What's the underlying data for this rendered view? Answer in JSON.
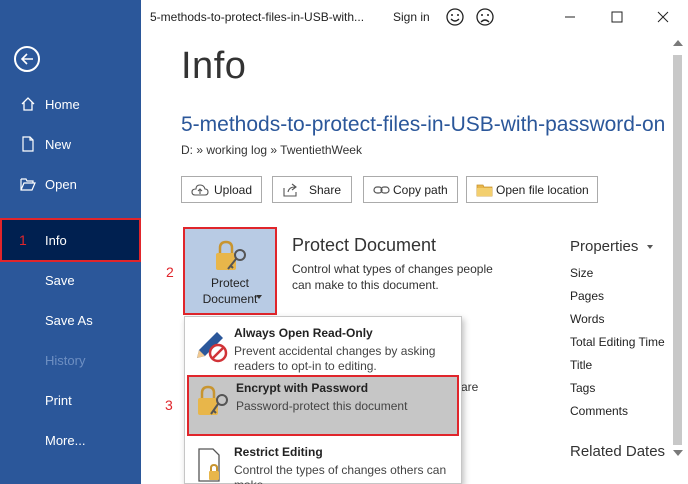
{
  "sidebar": {
    "items": [
      {
        "label": "Home",
        "icon": "home-icon"
      },
      {
        "label": "New",
        "icon": "new-document-icon"
      },
      {
        "label": "Open",
        "icon": "open-folder-icon"
      },
      {
        "label": "Info"
      },
      {
        "label": "Save"
      },
      {
        "label": "Save As"
      },
      {
        "label": "History",
        "disabled": true
      },
      {
        "label": "Print"
      },
      {
        "label": "More..."
      }
    ],
    "active_item": "Info"
  },
  "annotations": {
    "step1": "1",
    "step2": "2",
    "step3": "3"
  },
  "titlebar": {
    "doc_title": "5-methods-to-protect-files-in-USB-with...",
    "sign_in": "Sign in",
    "icons": [
      "smile-icon",
      "frown-icon",
      "minimize-icon",
      "maximize-icon",
      "close-icon"
    ]
  },
  "main": {
    "page_title": "Info",
    "doc_name": "5-methods-to-protect-files-in-USB-with-password-on",
    "doc_path": "D: » working log » TwentiethWeek",
    "actions": [
      {
        "label": "Upload",
        "icon": "upload-cloud-icon"
      },
      {
        "label": "Share",
        "icon": "share-icon"
      },
      {
        "label": "Copy path",
        "icon": "link-icon"
      },
      {
        "label": "Open file location",
        "icon": "folder-icon"
      }
    ],
    "protect": {
      "tile_line1": "Protect",
      "tile_line2": "Document",
      "title": "Protect Document",
      "description": "Control what types of changes people can make to this document.",
      "peek_text": "are"
    }
  },
  "properties": {
    "title": "Properties",
    "items": [
      "Size",
      "Pages",
      "Words",
      "Total Editing Time",
      "Title",
      "Tags",
      "Comments"
    ],
    "related_title": "Related Dates"
  },
  "menu": {
    "items": [
      {
        "title": "Always Open Read-Only",
        "description": "Prevent accidental changes by asking readers to opt-in to editing.",
        "icon": "pencil-no-icon"
      },
      {
        "title": "Encrypt with Password",
        "description": "Password-protect this document",
        "icon": "lock-key-icon",
        "highlighted": true
      },
      {
        "title": "Restrict Editing",
        "description": "Control the types of changes others can make",
        "icon": "restrict-document-icon"
      }
    ]
  },
  "colors": {
    "sidebar": "#2b579a",
    "sidebar_active": "#002050",
    "annotation": "#e0252b",
    "accent_text": "#2b579a",
    "tile": "#b8cbe4",
    "menu_highlight": "#c6c6c6"
  }
}
